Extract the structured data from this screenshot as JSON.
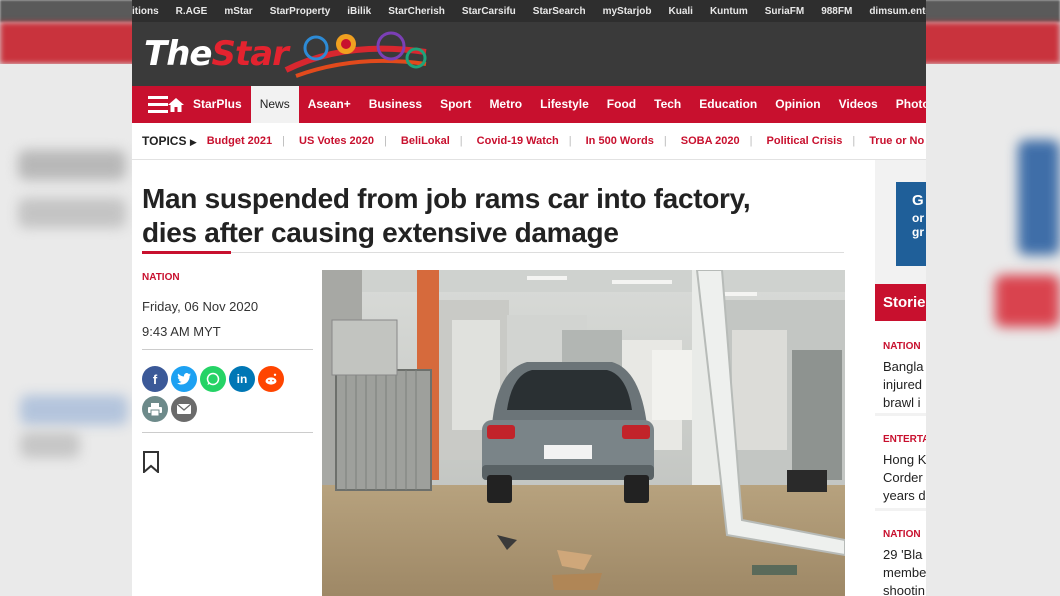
{
  "top_links": [
    "itions",
    "R.AGE",
    "mStar",
    "StarProperty",
    "iBilik",
    "StarCherish",
    "StarCarsifu",
    "StarSearch",
    "myStarjob",
    "Kuali",
    "Kuntum",
    "SuriaFM",
    "988FM",
    "dimsum.entert"
  ],
  "logo": {
    "the": "The",
    "star": "Star"
  },
  "nav": {
    "items": [
      "StarPlus",
      "News",
      "Asean+",
      "Business",
      "Sport",
      "Metro",
      "Lifestyle",
      "Food",
      "Tech",
      "Education",
      "Opinion",
      "Videos",
      "Photos"
    ],
    "active": "News"
  },
  "topics": {
    "label": "TOPICS",
    "items": [
      "Budget 2021",
      "US Votes 2020",
      "BeliLokal",
      "Covid-19 Watch",
      "In 500 Words",
      "SOBA 2020",
      "Political Crisis",
      "True or No"
    ]
  },
  "article": {
    "headline_line1": "Man suspended from job rams car into factory,",
    "headline_line2": "dies after causing extensive damage",
    "section": "NATION",
    "date": "Friday, 06 Nov 2020",
    "time": "9:43 AM MYT",
    "share": [
      "facebook-icon",
      "twitter-icon",
      "whatsapp-icon",
      "linkedin-icon",
      "reddit-icon",
      "print-icon",
      "email-icon"
    ],
    "share_colors": {
      "facebook": "#3b5998",
      "twitter": "#1da1f2",
      "whatsapp": "#25d366",
      "linkedin": "#0077b5",
      "reddit": "#ff4500",
      "print": "#6d8a8a",
      "email": "#6b6b6b"
    }
  },
  "rail": {
    "ad_text": [
      "G",
      "or",
      "gr"
    ],
    "stories_head": "Storie",
    "stories": [
      {
        "tag": "NATION",
        "lines": [
          "Bangla",
          "injured",
          "brawl i"
        ]
      },
      {
        "tag": "ENTERTA",
        "lines": [
          "Hong K",
          "Corder",
          "years d"
        ]
      },
      {
        "tag": "NATION",
        "lines": [
          "29 'Bla",
          "membe",
          "shootin"
        ]
      }
    ]
  },
  "colors": {
    "brand_red": "#c8102e",
    "banner": "#3a3a3a"
  }
}
